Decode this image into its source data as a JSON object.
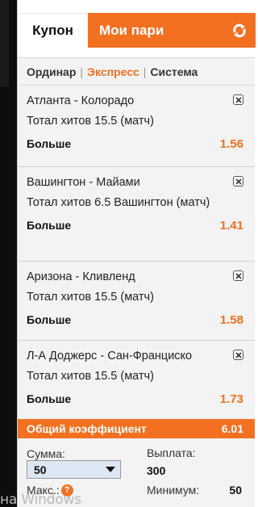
{
  "tabs": {
    "coupon_label": "Купон",
    "my_bets_label": "Мои пари"
  },
  "modes": {
    "single": "Ординар",
    "express": "Экспресс",
    "system": "Система",
    "active": "Экспресс"
  },
  "bets": [
    {
      "title": "Атланта - Колорадо",
      "market": "Тотал хитов 15.5 (матч)",
      "pick": "Больше",
      "odd": "1.56"
    },
    {
      "title": "Вашингтон - Майами",
      "market": "Тотал хитов 6.5 Вашингтон (матч)",
      "pick": "Больше",
      "odd": "1.41"
    },
    {
      "title": "Аризона - Кливленд",
      "market": "Тотал хитов 15.5 (матч)",
      "pick": "Больше",
      "odd": "1.58"
    },
    {
      "title": "Л-А Доджерс - Сан-Франциско",
      "market": "Тотал хитов 15.5 (матч)",
      "pick": "Больше",
      "odd": "1.73"
    }
  ],
  "total": {
    "label": "Общий коэффициент",
    "value": "6.01"
  },
  "stake": {
    "label": "Сумма:",
    "selected": "50",
    "max_label": "Макс.:",
    "help_symbol": "?"
  },
  "payout": {
    "label": "Выплата:",
    "value": "300",
    "min_label": "Минимум:",
    "min_value": "50"
  },
  "watermark": "на Windows",
  "colors": {
    "accent": "#f37021",
    "background": "#f3f3f3"
  }
}
